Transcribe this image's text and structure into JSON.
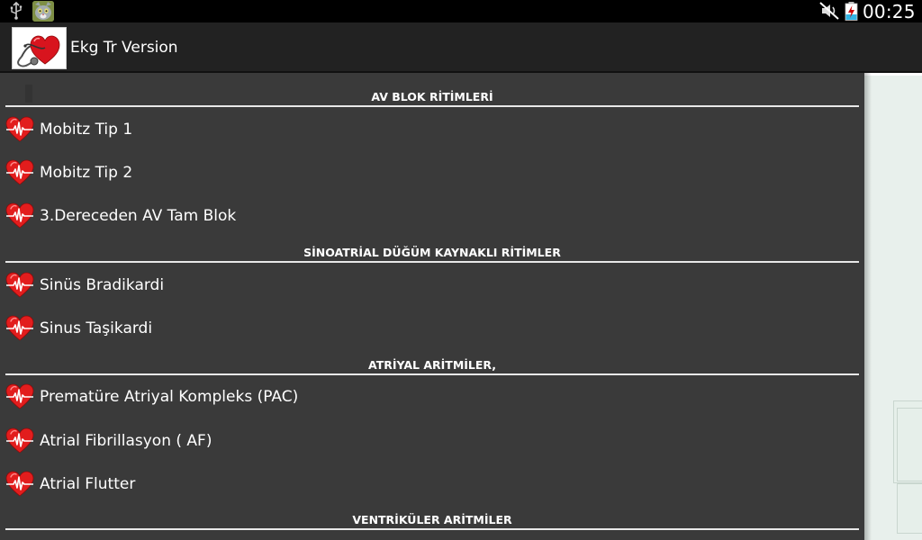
{
  "status_bar": {
    "time": "00:25",
    "icons": [
      "usb-icon",
      "talking-tom-notification-icon",
      "mute-icon",
      "battery-charging-icon"
    ]
  },
  "action_bar": {
    "title": "Ekg Tr Version",
    "logo_icon": "heart-stethoscope-logo"
  },
  "colors": {
    "background": "#3a3a3a",
    "divider": "#e8e8e8",
    "heart": "#e02020",
    "text": "#ffffff"
  },
  "sections": [
    {
      "header": "AV BLOK RİTİMLERİ",
      "items": [
        "Mobitz Tip 1",
        "Mobitz Tip 2",
        "3.Dereceden AV Tam Blok"
      ]
    },
    {
      "header": "SİNOATRİAL DÜĞÜM KAYNAKLI RİTİMLER",
      "items": [
        "Sinüs Bradikardi",
        "Sinus Taşikardi"
      ]
    },
    {
      "header": "ATRİYAL ARİTMİLER,",
      "items": [
        "Prematüre Atriyal Kompleks (PAC)",
        "Atrial Fibrillasyon ( AF)",
        "Atrial Flutter"
      ]
    },
    {
      "header": "VENTRİKÜLER ARİTMİLER",
      "items": []
    }
  ]
}
